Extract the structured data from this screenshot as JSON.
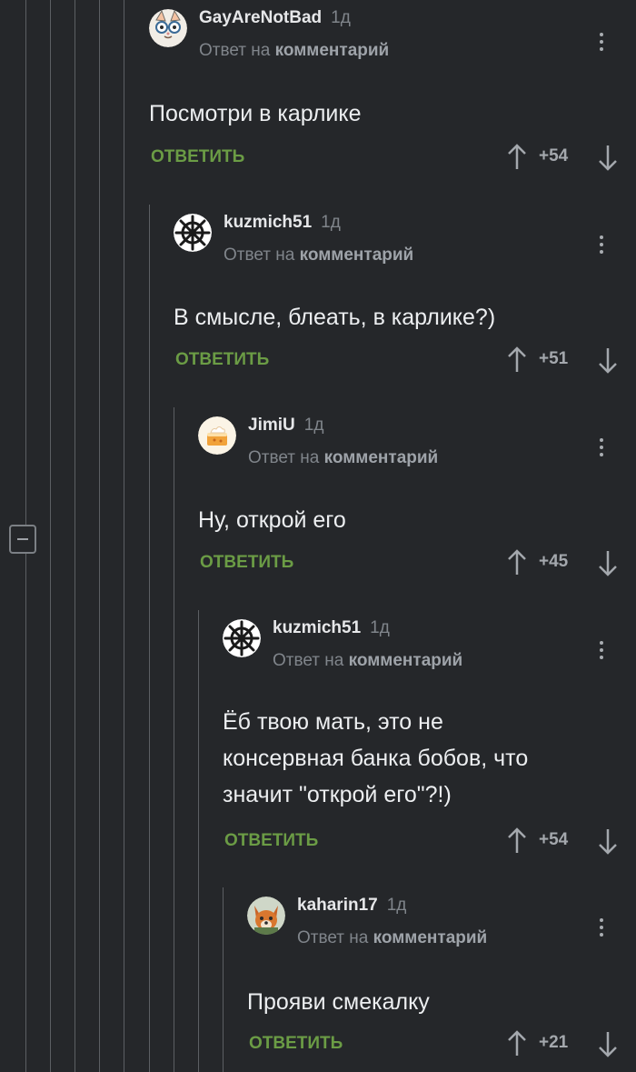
{
  "collapse_label": "collapse-thread",
  "colors": {
    "background": "#25272a",
    "reply_button": "#6b9c45",
    "thread_line": "#5c5f63",
    "text": "#eceef0",
    "muted": "#80858b"
  },
  "comments": [
    {
      "author": "GayAreNotBad",
      "time": "1д",
      "reply_prefix": "Ответ на",
      "reply_target": "комментарий",
      "text": "Посмотри в карлике",
      "reply_label": "ОТВЕТИТЬ",
      "rating": "+54",
      "avatar": "cat-glasses-avatar"
    },
    {
      "author": "kuzmich51",
      "time": "1д",
      "reply_prefix": "Ответ на",
      "reply_target": "комментарий",
      "text": "В смысле, блеать, в карлике?)",
      "reply_label": "ОТВЕТИТЬ",
      "rating": "+51",
      "avatar": "ship-wheel-avatar"
    },
    {
      "author": "JimiU",
      "time": "1д",
      "reply_prefix": "Ответ на",
      "reply_target": "комментарий",
      "text": "Ну, открой его",
      "reply_label": "ОТВЕТИТЬ",
      "rating": "+45",
      "avatar": "cake-avatar"
    },
    {
      "author": "kuzmich51",
      "time": "1д",
      "reply_prefix": "Ответ на",
      "reply_target": "комментарий",
      "text": "Ёб твою мать, это не\nконсервная банка бобов, что\nзначит \"открой его\"?!)",
      "reply_label": "ОТВЕТИТЬ",
      "rating": "+54",
      "avatar": "ship-wheel-avatar"
    },
    {
      "author": "kaharin17",
      "time": "1д",
      "reply_prefix": "Ответ на",
      "reply_target": "комментарий",
      "text": "Прояви смекалку",
      "reply_label": "ОТВЕТИТЬ",
      "rating": "+21",
      "avatar": "fox-avatar"
    }
  ]
}
